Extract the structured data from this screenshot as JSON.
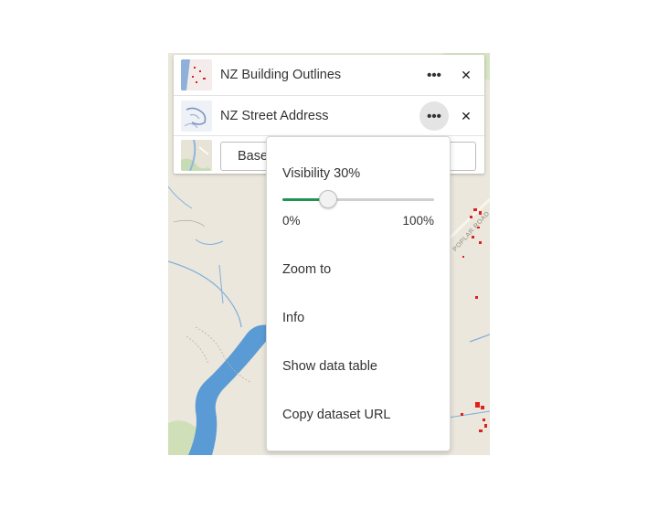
{
  "layers": [
    {
      "name": "NZ Building Outlines",
      "thumb_icon": "building-outlines-thumbnail-icon"
    },
    {
      "name": "NZ Street Address",
      "thumb_icon": "street-address-thumbnail-icon"
    }
  ],
  "basemap": {
    "label": "Base",
    "thumb_icon": "basemap-thumbnail-icon"
  },
  "layer_actions": {
    "more_glyph": "•••",
    "close_glyph": "✕"
  },
  "menu": {
    "visibility_label": "Visibility 30%",
    "visibility_value_percent": 30,
    "range_min": "0%",
    "range_max": "100%",
    "items": [
      "Zoom to",
      "Info",
      "Show data table",
      "Copy dataset URL"
    ]
  },
  "map": {
    "road_label": "POPLAR ROAD"
  },
  "colors": {
    "accent": "#1e9650",
    "river": "#5b9bd5",
    "building": "#e0201b",
    "land": "#ebe7dc"
  }
}
